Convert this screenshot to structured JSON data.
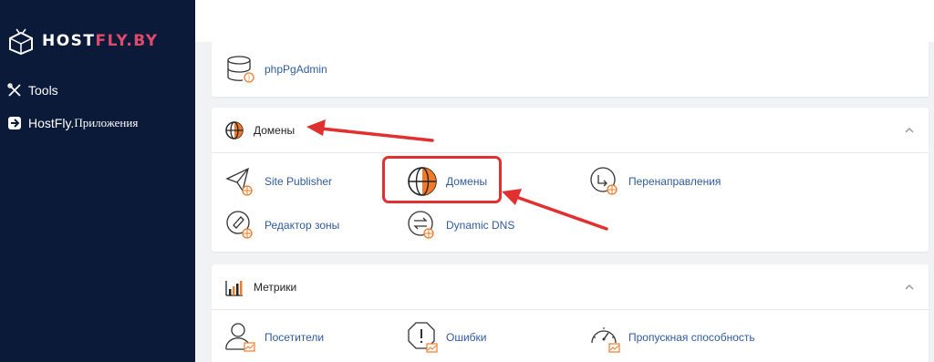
{
  "brand": {
    "name_part1": "HOST",
    "name_part2": "FLY.BY",
    "accent": "#e04a6a"
  },
  "sidebar": {
    "items": [
      {
        "label": "Tools",
        "icon": "tools-icon"
      },
      {
        "label": "HostFly.",
        "label2": "Приложения",
        "icon": "app-icon"
      }
    ]
  },
  "panels": {
    "databases": {
      "items": [
        {
          "label": "phpPgAdmin",
          "icon": "database-icon"
        }
      ]
    },
    "domains": {
      "title": "Домены",
      "items": [
        {
          "label": "Site Publisher",
          "icon": "paper-plane-icon"
        },
        {
          "label": "Домены",
          "icon": "globe-icon"
        },
        {
          "label": "Перенаправления",
          "icon": "redirect-icon"
        },
        {
          "label": "Редактор зоны",
          "icon": "zone-editor-icon"
        },
        {
          "label": "Dynamic DNS",
          "icon": "dynamic-dns-icon"
        }
      ]
    },
    "metrics": {
      "title": "Метрики",
      "items": [
        {
          "label": "Посетители",
          "icon": "visitors-icon"
        },
        {
          "label": "Ошибки",
          "icon": "errors-icon"
        },
        {
          "label": "Пропускная способность",
          "icon": "bandwidth-icon"
        }
      ]
    }
  },
  "colors": {
    "sidebar_bg": "#0b1a38",
    "link": "#2f5b9e",
    "annotation": "#e03030",
    "icon_accent": "#f07a2a"
  }
}
